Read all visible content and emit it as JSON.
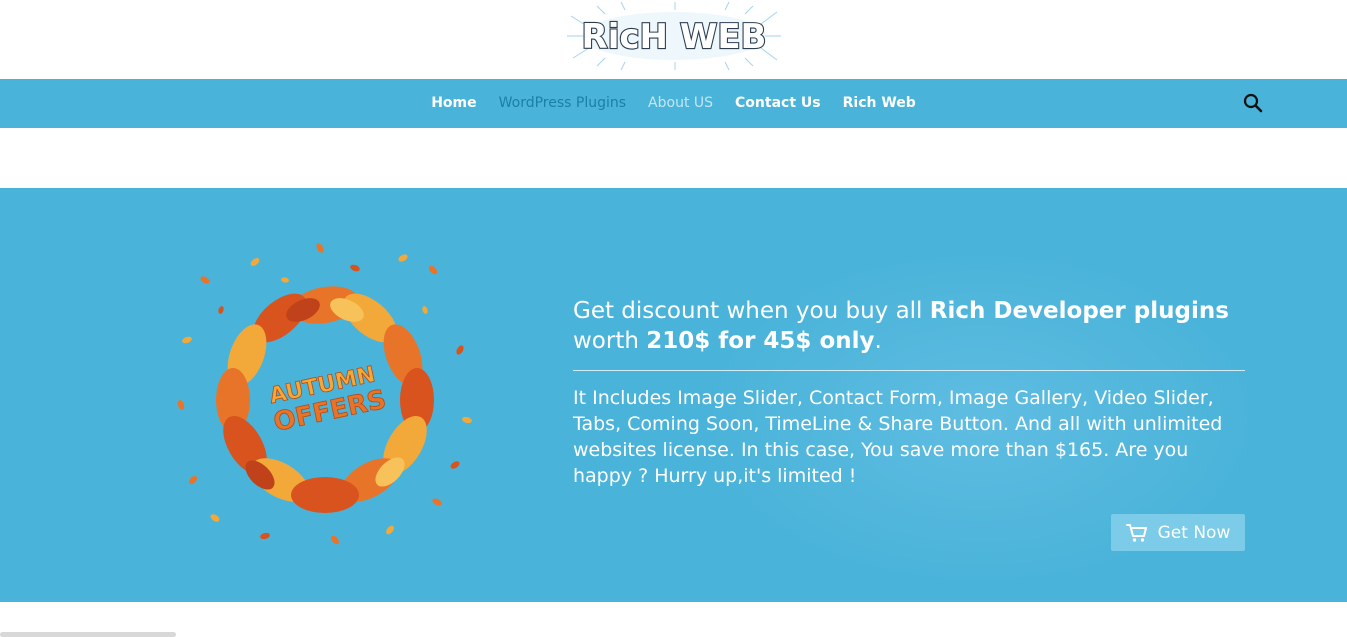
{
  "header": {
    "logo_text": "RicH WEB"
  },
  "nav": {
    "items": [
      {
        "label": "Home"
      },
      {
        "label": "WordPress Plugins"
      },
      {
        "label": "About US"
      },
      {
        "label": "Contact Us"
      },
      {
        "label": "Rich Web"
      }
    ],
    "search_icon": "search-icon"
  },
  "promo": {
    "badge_line1": "AUTUMN",
    "badge_line2": "OFFERS",
    "headline_part1": "Get discount when you buy all ",
    "headline_bold1": "Rich Developer plugins",
    "headline_part2": " worth ",
    "headline_bold2": "210$ for 45$ only",
    "headline_part3": ".",
    "description": "It Includes Image Slider, Contact Form, Image Gallery, Video Slider, Tabs, Coming Soon, TimeLine & Share Button. And all with unlimited websites license. In this case, You save more than $165. Are you happy ? Hurry up,it's limited !",
    "button_label": "Get Now",
    "button_icon": "cart-icon"
  },
  "colors": {
    "brand_blue": "#4ab3d9",
    "nav_active": "#1a7fa8",
    "button_bg": "#7ccbe8",
    "leaf_orange": "#e8742a",
    "leaf_yellow": "#f3a93a"
  }
}
